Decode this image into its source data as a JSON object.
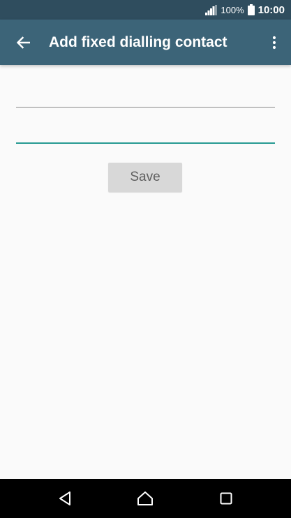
{
  "status_bar": {
    "battery_text": "100%",
    "time": "10:00",
    "icons": [
      "signal-icon",
      "battery-icon"
    ]
  },
  "app_bar": {
    "title": "Add fixed dialling contact",
    "icons": [
      "back-arrow-icon",
      "overflow-menu-icon"
    ]
  },
  "form": {
    "name_field": {
      "value": "",
      "placeholder": ""
    },
    "number_field": {
      "value": "",
      "placeholder": ""
    },
    "save_label": "Save"
  },
  "nav_bar": {
    "icons": [
      "nav-back-icon",
      "nav-home-icon",
      "nav-recents-icon"
    ]
  },
  "colors": {
    "status_bar": "#2f4d5e",
    "app_bar": "#3c6478",
    "accent": "#279a92",
    "background": "#fafafa",
    "button": "#d8d8d8"
  }
}
